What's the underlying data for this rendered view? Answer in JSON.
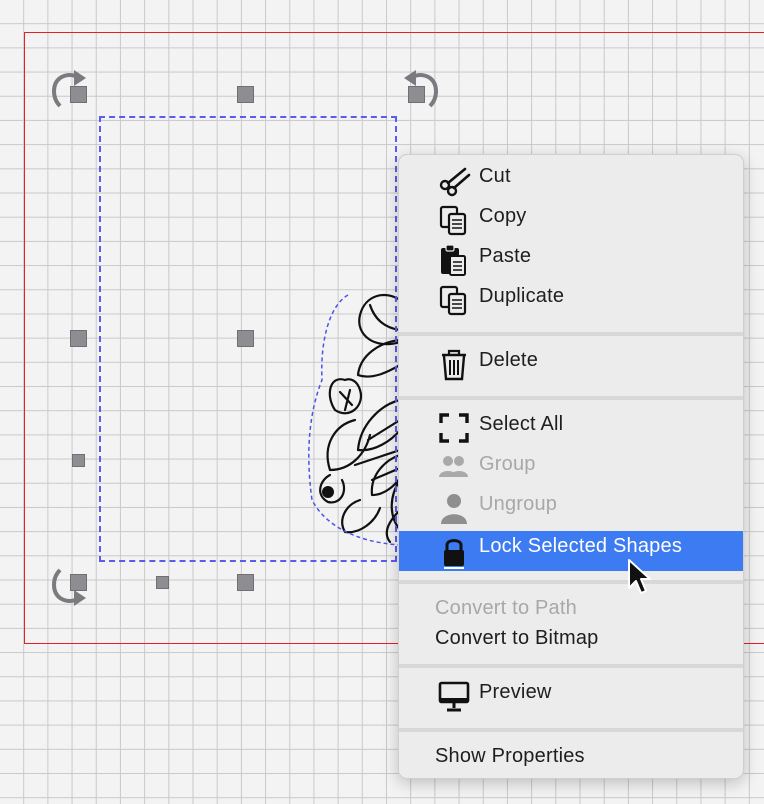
{
  "menu": {
    "cut": "Cut",
    "copy": "Copy",
    "paste": "Paste",
    "duplicate": "Duplicate",
    "delete": "Delete",
    "select_all": "Select All",
    "group": "Group",
    "ungroup": "Ungroup",
    "lock_selected": "Lock Selected Shapes",
    "convert_to_path": "Convert to Path",
    "convert_to_bitmap": "Convert to Bitmap",
    "preview": "Preview",
    "show_properties": "Show Properties"
  },
  "icons": {
    "cut": "scissors-icon",
    "copy": "copy-icon",
    "paste": "clipboard-icon",
    "duplicate": "duplicate-icon",
    "delete": "trash-icon",
    "select_all": "select-all-icon",
    "group": "group-icon",
    "ungroup": "person-icon",
    "lock": "lock-icon",
    "preview": "monitor-icon",
    "rotate": "rotate-arrow-icon"
  },
  "colors": {
    "highlight": "#3c7bf1",
    "selection": "#5a5cf0",
    "page_border": "#e32222",
    "disabled_text": "#a8a8a8"
  },
  "state": {
    "hovered_item": "Lock Selected Shapes",
    "disabled_items": [
      "Group",
      "Ungroup",
      "Convert to Path"
    ]
  }
}
